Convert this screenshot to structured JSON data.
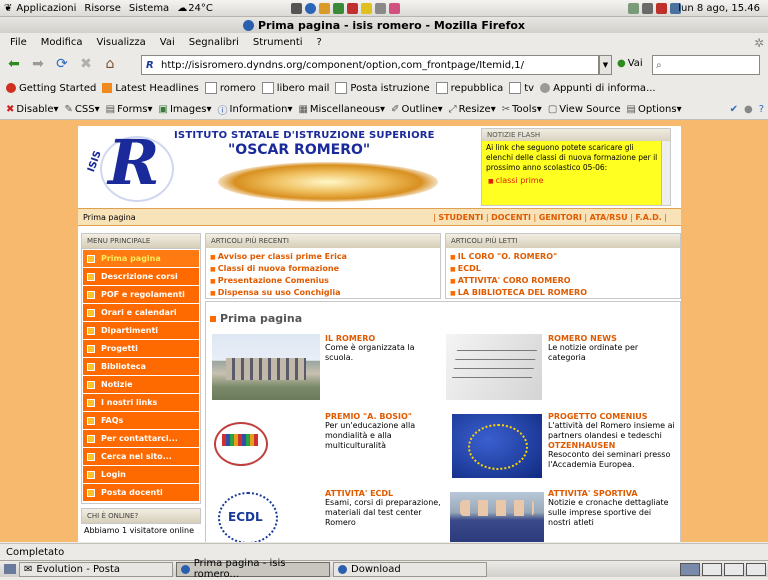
{
  "panel": {
    "menus": [
      "Applicazioni",
      "Risorse",
      "Sistema"
    ],
    "weather": "24°C",
    "datetime": "lun 8 ago, 15.46"
  },
  "window": {
    "title": "Prima pagina - isis romero - Mozilla Firefox"
  },
  "menubar": [
    "File",
    "Modifica",
    "Visualizza",
    "Vai",
    "Segnalibri",
    "Strumenti",
    "?"
  ],
  "navbar": {
    "url": "http://isisromero.dyndns.org/component/option,com_frontpage/Itemid,1/",
    "go_label": "Vai"
  },
  "bookmarks": [
    "Getting Started",
    "Latest Headlines",
    "romero",
    "libero mail",
    "Posta istruzione",
    "repubblica",
    "tv",
    "Appunti di informa..."
  ],
  "devbar": [
    "Disable",
    "CSS",
    "Forms",
    "Images",
    "Information",
    "Miscellaneous",
    "Outline",
    "Resize",
    "Tools",
    "View Source",
    "Options"
  ],
  "site": {
    "header_line1": "ISTITUTO STATALE D'ISTRUZIONE SUPERIORE",
    "header_line2": "\"OSCAR ROMERO\"",
    "logo_letter": "R",
    "logo_side": "ISIS",
    "flash_title": "NOTIZIE FLASH",
    "flash_text": "Ai link che seguono potete scaricare gli elenchi delle classi di nuova formazione per il prossimo anno scolastico 05-06:",
    "flash_link": "classi prime",
    "breadcrumb": "Prima pagina",
    "toplinks": [
      "STUDENTI",
      "DOCENTI",
      "GENITORI",
      "ATA/RSU",
      "F.A.D."
    ],
    "menu_title": "MENU PRINCIPALE",
    "menu": [
      "Prima pagina",
      "Descrizione corsi",
      "POF e regolamenti",
      "Orari e calendari",
      "Dipartimenti",
      "Progetti",
      "Biblioteca",
      "Notizie",
      "I nostri links",
      "FAQs",
      "Per contattarci...",
      "Cerca nel sito...",
      "Login",
      "Posta docenti"
    ],
    "online_title": "CHI È ONLINE?",
    "online_text": "Abbiamo 1 visitatore online",
    "recent_title": "ARTICOLI PIÙ RECENTI",
    "recent": [
      "Avviso per classi prime Erica",
      "Classi di nuova formazione",
      "Presentazione Comenius",
      "Dispensa su uso Conchiglia"
    ],
    "read_title": "ARTICOLI PIÙ LETTI",
    "read": [
      "IL CORO \"O. ROMERO\"",
      "ECDL",
      "ATTIVITA' CORO ROMERO",
      "LA BIBLIOTECA DEL ROMERO"
    ],
    "main_title": "Prima pagina",
    "cells": [
      {
        "title": "IL ROMERO",
        "desc": "Come è organizzata la scuola."
      },
      {
        "title": "ROMERO NEWS",
        "desc": "Le notizie ordinate per categoria"
      },
      {
        "title": "PREMIO \"A. BOSIO\"",
        "desc": "Per un'educazione alla mondialità e alla multiculturalità"
      },
      {
        "title": "PROGETTO COMENIUS",
        "desc": "L'attività del Romero insieme ai partners olandesi e tedeschi",
        "title2": "OTZENHAUSEN",
        "desc2": "Resoconto dei seminari presso l'Accademia Europea."
      },
      {
        "title": "ATTIVITA' ECDL",
        "desc": "Esami, corsi di preparazione, materiali dal test center Romero"
      },
      {
        "title": "ATTIVITA' SPORTIVA",
        "desc": "Notizie e cronache dettagliate sulle imprese sportive dei nostri atleti"
      }
    ],
    "ecdl_text": "ECDL"
  },
  "status": "Completato",
  "taskbar": [
    "Evolution - Posta",
    "Prima pagina - isis romero...",
    "Download"
  ]
}
